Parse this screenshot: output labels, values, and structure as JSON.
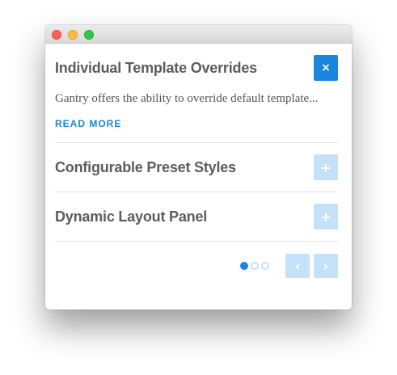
{
  "accordion": {
    "items": [
      {
        "title": "Individual Template Overrides",
        "description": "Gantry offers the ability to override default template...",
        "read_more": "READ MORE",
        "toggle_icon": "×",
        "toggle_icon_name": "close-icon",
        "expanded": true
      },
      {
        "title": "Configurable Preset Styles",
        "toggle_icon": "+",
        "toggle_icon_name": "plus-icon",
        "expanded": false
      },
      {
        "title": "Dynamic Layout Panel",
        "toggle_icon": "+",
        "toggle_icon_name": "plus-icon",
        "expanded": false
      }
    ]
  },
  "pager": {
    "pages": 3,
    "current": 1,
    "prev_icon": "‹",
    "next_icon": "›"
  },
  "colors": {
    "accent": "#1b86e0",
    "accent_light": "#c5e1f8",
    "title_text": "#5c5c5c",
    "body_text": "#555555"
  }
}
